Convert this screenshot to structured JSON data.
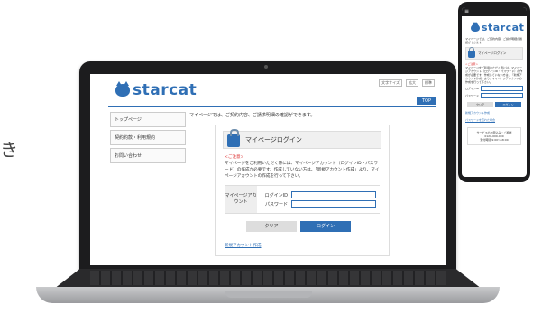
{
  "side_text": "き",
  "site": {
    "logo": "starcat",
    "util_links": [
      "文字サイズ",
      "拡大",
      "標準"
    ],
    "top_label": "TOP",
    "nav": [
      "トップページ",
      "契約約款・利用規約",
      "お問い合わせ"
    ],
    "intro": "マイページでは、ご契約内容、ご請求明細の確認ができます。",
    "login_title": "マイページログイン",
    "notice_title": "<ご注意>",
    "notice_body": "マイページをご利用いただく際には、マイページアカウント（ログインID・パスワード）の作成が必要です。作成していない方は、「新規アカウント作成」より、マイページアカウントの作成を行って下さい。",
    "form_section_label": "マイページアカウント",
    "login_id_label": "ログインID",
    "password_label": "パスワード",
    "clear_label": "クリア",
    "login_label": "ログイン",
    "new_account_link": "新規アカウント作成"
  },
  "phone": {
    "menu_icon": "≡",
    "logo": "starcat",
    "intro": "マイページでは、ご契約内容、ご請求明細の確認ができます。",
    "login_title": "マイページログイン",
    "notice_title": "<ご注意>",
    "notice_body": "マイページをご利用いただく際には、マイページアカウント（ログインID・パスワード）の作成が必要です。作成していない方は、「新規アカウント作成」より、マイページアカウントの作成を行って下さい。",
    "login_id_label": "ログインID",
    "password_label": "パスワード",
    "clear_label": "クリア",
    "login_label": "ログイン",
    "link1": "新規アカウント作成",
    "link2": "パスワードを忘れた場合",
    "footer_title": "サービスのお申込み・ご相談",
    "footer_phone": "0120-000-000",
    "footer_hours": "受付時間 9:00〜18:00"
  },
  "colors": {
    "brand": "#2f6fb5",
    "accent_red": "#dd3333"
  }
}
